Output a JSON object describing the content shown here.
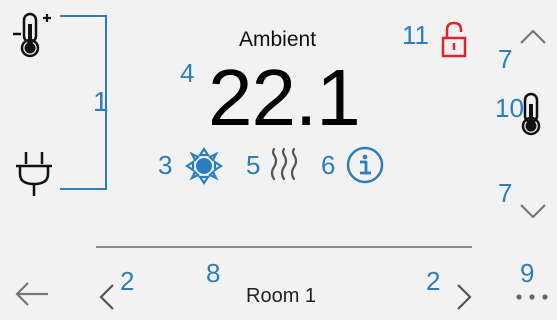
{
  "main": {
    "title": "Ambient",
    "temperature": "22.1",
    "room_name": "Room 1"
  },
  "callouts": {
    "c1": "1",
    "c2_left": "2",
    "c2_right": "2",
    "c3": "3",
    "c4": "4",
    "c5": "5",
    "c6": "6",
    "c7_top": "7",
    "c7_bottom": "7",
    "c8": "8",
    "c9": "9",
    "c10": "10",
    "c11": "11"
  },
  "icons": {
    "left_top": "thermometer-plus-icon",
    "left_bottom": "plug-icon",
    "sun": "sun-icon",
    "heat": "heat-waves-icon",
    "info": "info-icon",
    "lock": "unlocked-lock-icon",
    "up": "chevron-up-icon",
    "down": "chevron-down-icon",
    "thermo_right": "thermometer-icon",
    "back": "arrow-left-icon",
    "prev": "chevron-left-icon",
    "next": "chevron-right-icon",
    "more": "more-dots-icon"
  },
  "colors": {
    "accent": "#2a7fc3",
    "lock": "#e0242b",
    "text": "#000000",
    "background": "#f2f2f2"
  }
}
